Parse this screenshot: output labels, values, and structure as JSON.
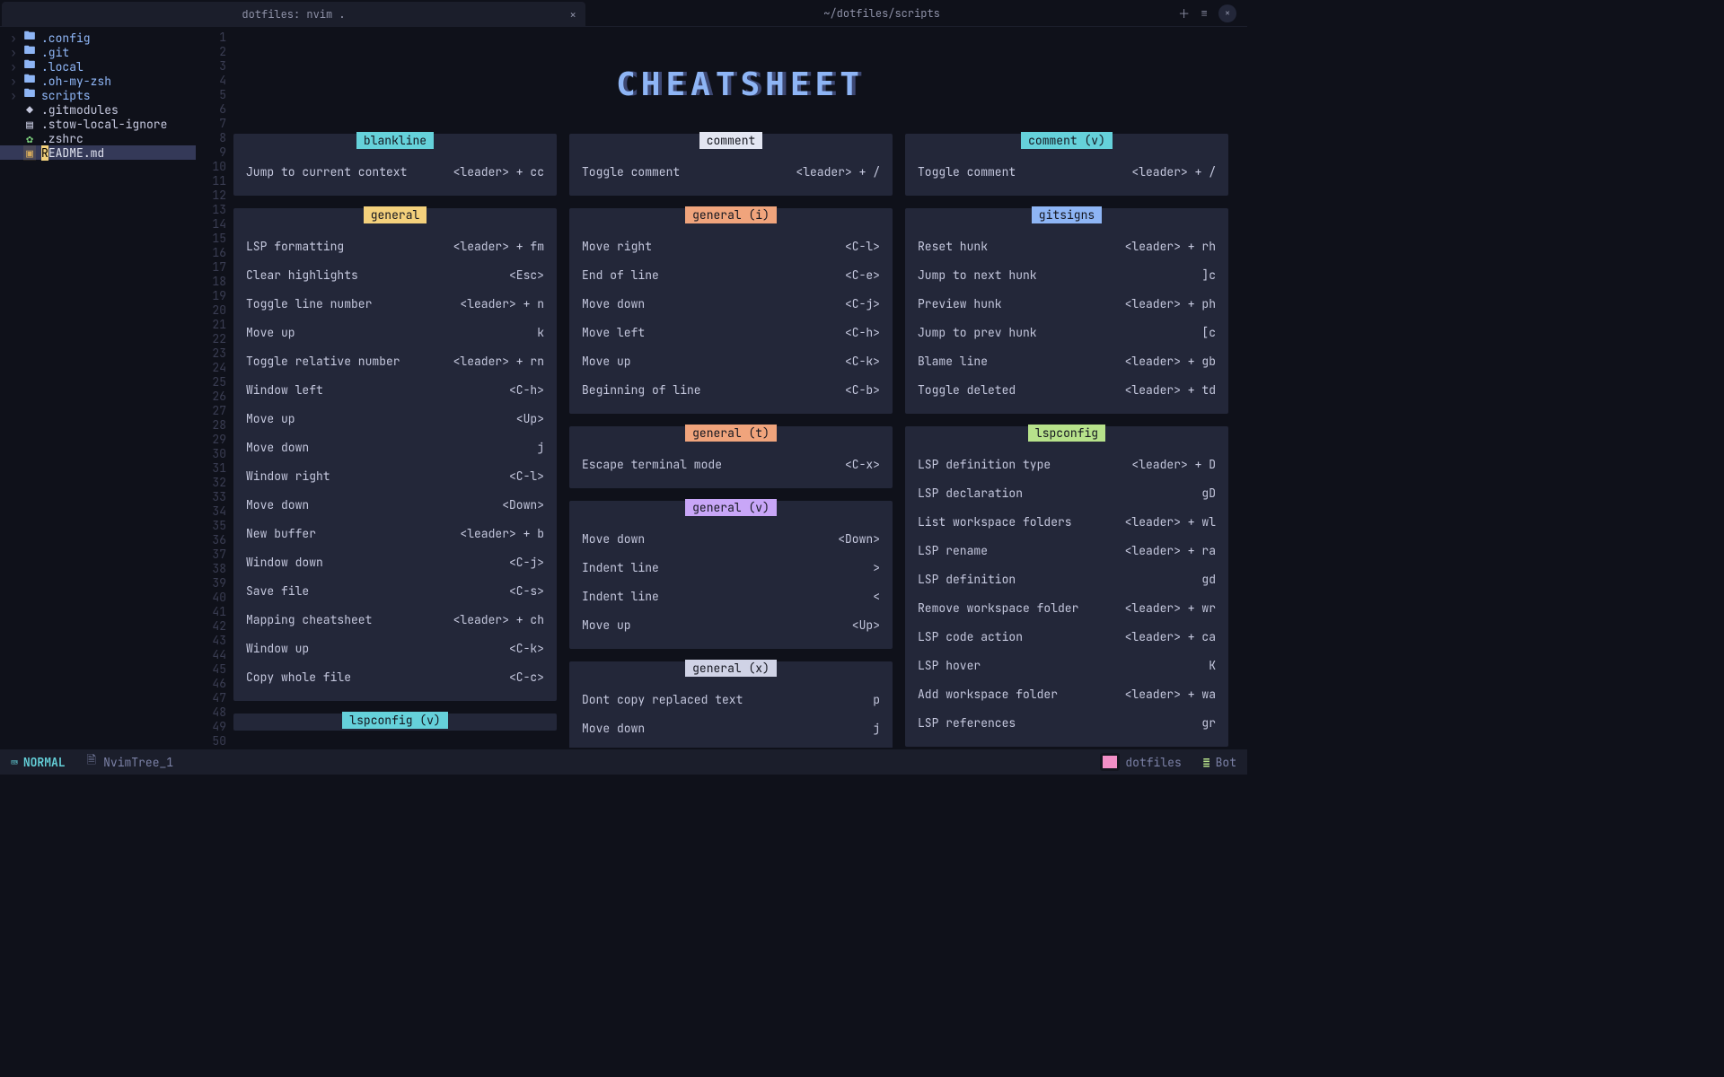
{
  "tabbar": {
    "tab_title": "dotfiles: nvim .",
    "center_path": "~/dotfiles/scripts"
  },
  "tree": [
    {
      "kind": "folder",
      "name": ".config",
      "expandable": true
    },
    {
      "kind": "folder",
      "name": ".git",
      "expandable": true
    },
    {
      "kind": "folder",
      "name": ".local",
      "expandable": true
    },
    {
      "kind": "folder",
      "name": ".oh-my-zsh",
      "expandable": true
    },
    {
      "kind": "folder",
      "name": "scripts",
      "expandable": true
    },
    {
      "kind": "file",
      "icon": "◆",
      "iconClass": "file-icon-diamond",
      "name": ".gitmodules"
    },
    {
      "kind": "file",
      "icon": "▤",
      "iconClass": "",
      "name": ".stow-local-ignore"
    },
    {
      "kind": "file",
      "icon": "✿",
      "iconClass": "file-icon-gear",
      "name": ".zshrc"
    },
    {
      "kind": "file",
      "icon": "▣",
      "iconClass": "file-icon-md",
      "name": "README.md",
      "selected": true,
      "readme": true
    }
  ],
  "line_count": 50,
  "banner": "CHEATSHEET",
  "columns": [
    [
      {
        "title": "blankline",
        "chip": "chip-teal",
        "rows": [
          {
            "lbl": "Jump to current context",
            "key": "<leader> + cc"
          }
        ]
      },
      {
        "title": "general",
        "chip": "chip-yellow",
        "rows": [
          {
            "lbl": "LSP formatting",
            "key": "<leader> + fm"
          },
          {
            "lbl": "Clear highlights",
            "key": "<Esc>"
          },
          {
            "lbl": "Toggle line number",
            "key": "<leader> + n"
          },
          {
            "lbl": "Move up",
            "key": "k"
          },
          {
            "lbl": "Toggle relative number",
            "key": "<leader> + rn"
          },
          {
            "lbl": "Window left",
            "key": "<C-h>"
          },
          {
            "lbl": "Move up",
            "key": "<Up>"
          },
          {
            "lbl": "Move down",
            "key": "j"
          },
          {
            "lbl": "Window right",
            "key": "<C-l>"
          },
          {
            "lbl": "Move down",
            "key": "<Down>"
          },
          {
            "lbl": "New buffer",
            "key": "<leader> + b"
          },
          {
            "lbl": "Window down",
            "key": "<C-j>"
          },
          {
            "lbl": "Save file",
            "key": "<C-s>"
          },
          {
            "lbl": "Mapping cheatsheet",
            "key": "<leader> + ch"
          },
          {
            "lbl": "Window up",
            "key": "<C-k>"
          },
          {
            "lbl": "Copy whole file",
            "key": "<C-c>"
          }
        ]
      },
      {
        "title": "lspconfig (v)",
        "chip": "chip-teal",
        "rows": [],
        "noPad": true
      }
    ],
    [
      {
        "title": "comment",
        "chip": "chip-white",
        "rows": [
          {
            "lbl": "Toggle comment",
            "key": "<leader> + /"
          }
        ]
      },
      {
        "title": "general (i)",
        "chip": "chip-orange",
        "rows": [
          {
            "lbl": "Move right",
            "key": "<C-l>"
          },
          {
            "lbl": "End of line",
            "key": "<C-e>"
          },
          {
            "lbl": "Move down",
            "key": "<C-j>"
          },
          {
            "lbl": "Move left",
            "key": "<C-h>"
          },
          {
            "lbl": "Move up",
            "key": "<C-k>"
          },
          {
            "lbl": "Beginning of line",
            "key": "<C-b>"
          }
        ]
      },
      {
        "title": "general (t)",
        "chip": "chip-orange",
        "rows": [
          {
            "lbl": "Escape terminal mode",
            "key": "<C-x>"
          }
        ]
      },
      {
        "title": "general (v)",
        "chip": "chip-purple",
        "rows": [
          {
            "lbl": "Move down",
            "key": "<Down>"
          },
          {
            "lbl": "Indent line",
            "key": ">"
          },
          {
            "lbl": "Indent line",
            "key": "<"
          },
          {
            "lbl": "Move up",
            "key": "<Up>"
          }
        ]
      },
      {
        "title": "general (x)",
        "chip": "chip-gray",
        "rows": [
          {
            "lbl": "Dont copy replaced text",
            "key": "p"
          },
          {
            "lbl": "Move down",
            "key": "j"
          }
        ]
      }
    ],
    [
      {
        "title": "comment (v)",
        "chip": "chip-teal",
        "rows": [
          {
            "lbl": "Toggle comment",
            "key": "<leader> + /"
          }
        ]
      },
      {
        "title": "gitsigns",
        "chip": "chip-blue",
        "rows": [
          {
            "lbl": "Reset hunk",
            "key": "<leader> + rh"
          },
          {
            "lbl": "Jump to next hunk",
            "key": "]c"
          },
          {
            "lbl": "Preview hunk",
            "key": "<leader> + ph"
          },
          {
            "lbl": "Jump to prev hunk",
            "key": "[c"
          },
          {
            "lbl": "Blame line",
            "key": "<leader> + gb"
          },
          {
            "lbl": "Toggle deleted",
            "key": "<leader> + td"
          }
        ]
      },
      {
        "title": "lspconfig",
        "chip": "chip-green",
        "rows": [
          {
            "lbl": "LSP definition type",
            "key": "<leader> + D"
          },
          {
            "lbl": "LSP declaration",
            "key": "gD"
          },
          {
            "lbl": "List workspace folders",
            "key": "<leader> + wl"
          },
          {
            "lbl": "LSP rename",
            "key": "<leader> + ra"
          },
          {
            "lbl": "LSP definition",
            "key": "gd"
          },
          {
            "lbl": "Remove workspace folder",
            "key": "<leader> + wr"
          },
          {
            "lbl": "LSP code action",
            "key": "<leader> + ca"
          },
          {
            "lbl": "LSP hover",
            "key": "K"
          },
          {
            "lbl": "Add workspace folder",
            "key": "<leader> + wa"
          },
          {
            "lbl": "LSP references",
            "key": "gr"
          }
        ]
      }
    ]
  ],
  "status": {
    "mode": "NORMAL",
    "file": "NvimTree_1",
    "git_branch": "dotfiles",
    "position": "Bot"
  }
}
